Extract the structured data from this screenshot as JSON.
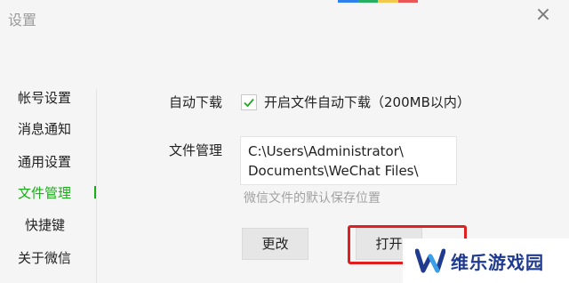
{
  "window": {
    "title": "设置",
    "close_glyph": "×"
  },
  "sidebar": {
    "items": [
      {
        "label": "帐号设置"
      },
      {
        "label": "消息通知"
      },
      {
        "label": "通用设置"
      },
      {
        "label": "文件管理"
      },
      {
        "label": "快捷键"
      },
      {
        "label": "关于微信"
      }
    ],
    "active_index": 3
  },
  "auto_download": {
    "label": "自动下载",
    "checked": true,
    "checkbox_text": "开启文件自动下载（200MB以内）"
  },
  "file_management": {
    "label": "文件管理",
    "path_line1": "C:\\Users\\Administrator\\",
    "path_line2": "Documents\\WeChat Files\\",
    "hint": "微信文件的默认保存位置"
  },
  "buttons": {
    "change": "更改",
    "open": "打开"
  },
  "watermark": {
    "text": "维乐游戏园",
    "logo_letter": "W"
  },
  "colors": {
    "accent": "#1aad19",
    "highlight": "#e02020",
    "watermark": "#1f3a8f",
    "deco_strip": [
      "#2f80ed",
      "#27ae60",
      "#f2c94c",
      "#eb5757"
    ]
  },
  "icons": {
    "close": "close-icon",
    "check": "check-icon",
    "logo": "logo-icon"
  }
}
